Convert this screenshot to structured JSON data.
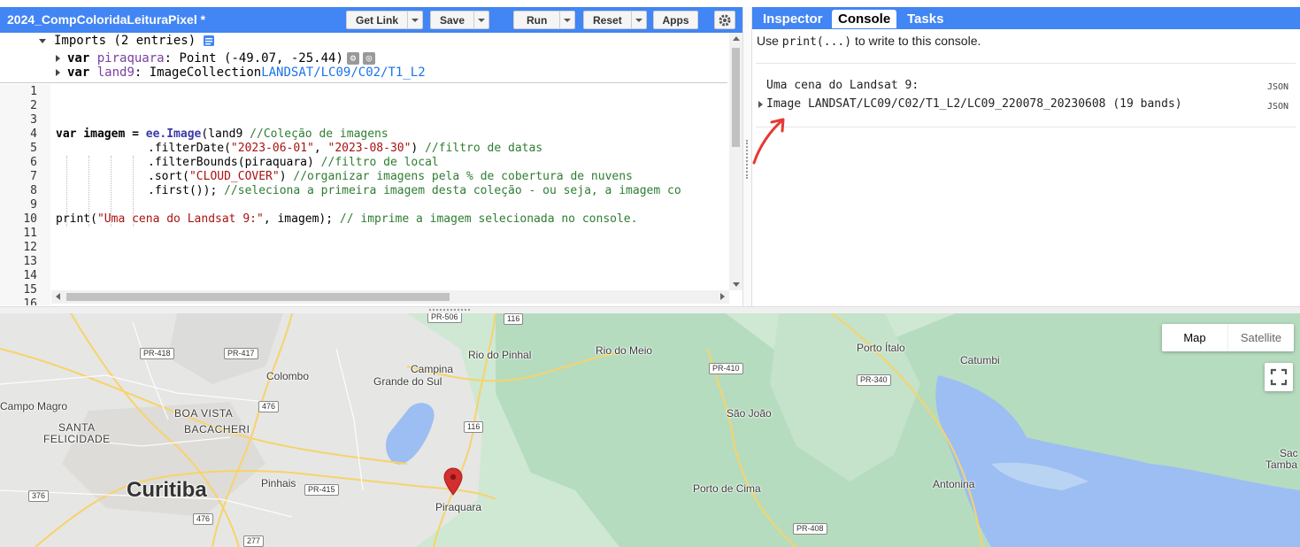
{
  "toolbar": {
    "script_title": "2024_CompColoridaLeituraPixel *",
    "get_link": "Get Link",
    "save": "Save",
    "run": "Run",
    "reset": "Reset",
    "apps": "Apps"
  },
  "imports": {
    "header": "Imports (2 entries)",
    "rows": [
      {
        "kw": "var",
        "name": "piraquara",
        "type": ": Point (-49.07, -25.44)",
        "link": ""
      },
      {
        "kw": "var",
        "name": "land9",
        "type": ": ImageCollection ",
        "link": "LANDSAT/LC09/C02/T1_L2"
      }
    ]
  },
  "code": {
    "line_numbers": [
      "1",
      "2",
      "3",
      "4",
      "5",
      "6",
      "7",
      "8",
      "9",
      "10",
      "11",
      "12",
      "13",
      "14",
      "15",
      "16"
    ],
    "lines": {
      "l4a": "var imagem = ",
      "l4b": "ee.Image",
      "l4c": "(land9 ",
      "l4d": "//Coleção de imagens",
      "l5a": ".filterDate(",
      "l5b": "\"2023-06-01\"",
      "l5c": ", ",
      "l5d": "\"2023-08-30\"",
      "l5e": ") ",
      "l5f": "//filtro de datas",
      "l6a": ".filterBounds(piraquara) ",
      "l6b": "//filtro de local",
      "l7a": ".sort(",
      "l7b": "\"CLOUD_COVER\"",
      "l7c": ") ",
      "l7d": "//organizar imagens pela % de cobertura de nuvens",
      "l8a": ".first()); ",
      "l8b": "//seleciona a primeira imagem desta coleção - ou seja, a imagem co",
      "l10a": "print(",
      "l10b": "\"Uma cena do Landsat 9:\"",
      "l10c": ", imagem); ",
      "l10d": "// imprime a imagem selecionada no console."
    }
  },
  "right_panel": {
    "tabs": [
      "Inspector",
      "Console",
      "Tasks"
    ],
    "active_tab": "Console",
    "hint_pre": "Use ",
    "hint_code": "print(...)",
    "hint_post": " to write to this console.",
    "output": [
      {
        "text": "Uma cena do Landsat 9:",
        "json": "JSON"
      },
      {
        "text": "Image LANDSAT/LC09/C02/T1_L2/LC09_220078_20230608 (19 bands)",
        "json": "JSON"
      }
    ]
  },
  "map": {
    "map_type": {
      "map": "Map",
      "satellite": "Satellite"
    },
    "places": {
      "curitiba": "Curitiba",
      "colombo": "Colombo",
      "campina1": "Campina",
      "campina2": "Grande do Sul",
      "rio_do_pinhal": "Rio do Pinhal",
      "rio_do_meio": "Rio do Meio",
      "porto_italo": "Porto Ítalo",
      "catumbi": "Catumbi",
      "sao_joao": "São João",
      "campo_magro": "Campo Magro",
      "boa_vista": "BOA VISTA",
      "bacacheri": "BACACHERI",
      "santa": "SANTA",
      "felicidade": "FELICIDADE",
      "pinhais": "Pinhais",
      "piraquara": "Piraquara",
      "porto_de_cima": "Porto de Cima",
      "antonina": "Antonina",
      "sac": "Sac",
      "tamba": "Tamba"
    },
    "shields": {
      "pr506": "PR-506",
      "r116a": "116",
      "pr418": "PR-418",
      "pr417": "PR-417",
      "pr410": "PR-410",
      "pr340": "PR-340",
      "r476a": "476",
      "r116b": "116",
      "pr415": "PR-415",
      "r376": "376",
      "r476b": "476",
      "r277": "277",
      "pr408": "PR-408"
    }
  },
  "colors": {
    "accent": "#4285f4",
    "annotation_arrow": "#e53935",
    "map_green": "#c9e8cf",
    "water": "#9dbef2",
    "urban": "#e8e8e8",
    "road": "#f7d36b",
    "pin": "#d32f2f"
  }
}
